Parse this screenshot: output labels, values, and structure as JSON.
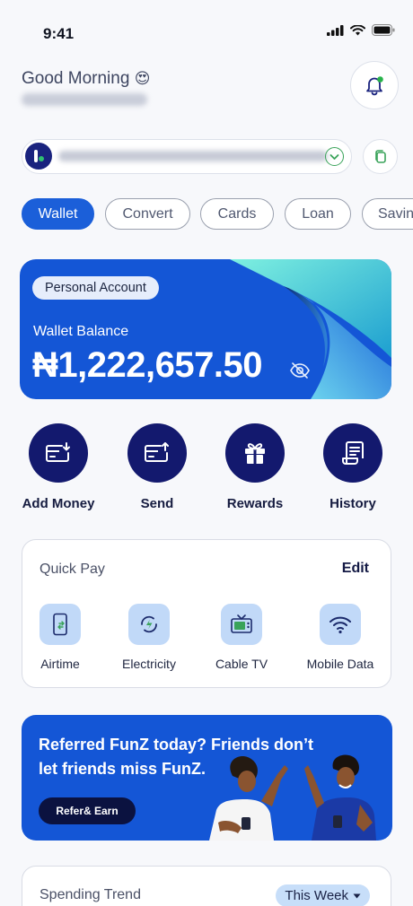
{
  "status_bar": {
    "time": "9:41"
  },
  "greeting": {
    "text": "Good Morning",
    "emoji": "😍"
  },
  "tabs": [
    {
      "label": "Wallet",
      "active": true
    },
    {
      "label": "Convert",
      "active": false
    },
    {
      "label": "Cards",
      "active": false
    },
    {
      "label": "Loan",
      "active": false
    },
    {
      "label": "Savings",
      "active": false
    }
  ],
  "wallet": {
    "account_type": "Personal Account",
    "balance_label": "Wallet Balance",
    "balance": "₦1,222,657.50"
  },
  "actions": [
    {
      "label": "Add Money",
      "icon": "add-money-icon"
    },
    {
      "label": "Send",
      "icon": "send-icon"
    },
    {
      "label": "Rewards",
      "icon": "gift-icon"
    },
    {
      "label": "History",
      "icon": "receipt-icon"
    }
  ],
  "quick_pay": {
    "title": "Quick Pay",
    "edit_label": "Edit",
    "items": [
      {
        "label": "Airtime",
        "icon": "phone-icon"
      },
      {
        "label": "Electricity",
        "icon": "electricity-icon"
      },
      {
        "label": "Cable TV",
        "icon": "tv-icon"
      },
      {
        "label": "Mobile Data",
        "icon": "wifi-icon"
      }
    ]
  },
  "referral": {
    "text": "Referred FunZ today? Friends don’t let friends miss FunZ.",
    "button": "Refer& Earn"
  },
  "spending_trend": {
    "title": "Spending Trend",
    "period": "This Week"
  },
  "colors": {
    "primary": "#1456d6",
    "navy": "#13196e",
    "accent_green": "#3aa35a"
  }
}
